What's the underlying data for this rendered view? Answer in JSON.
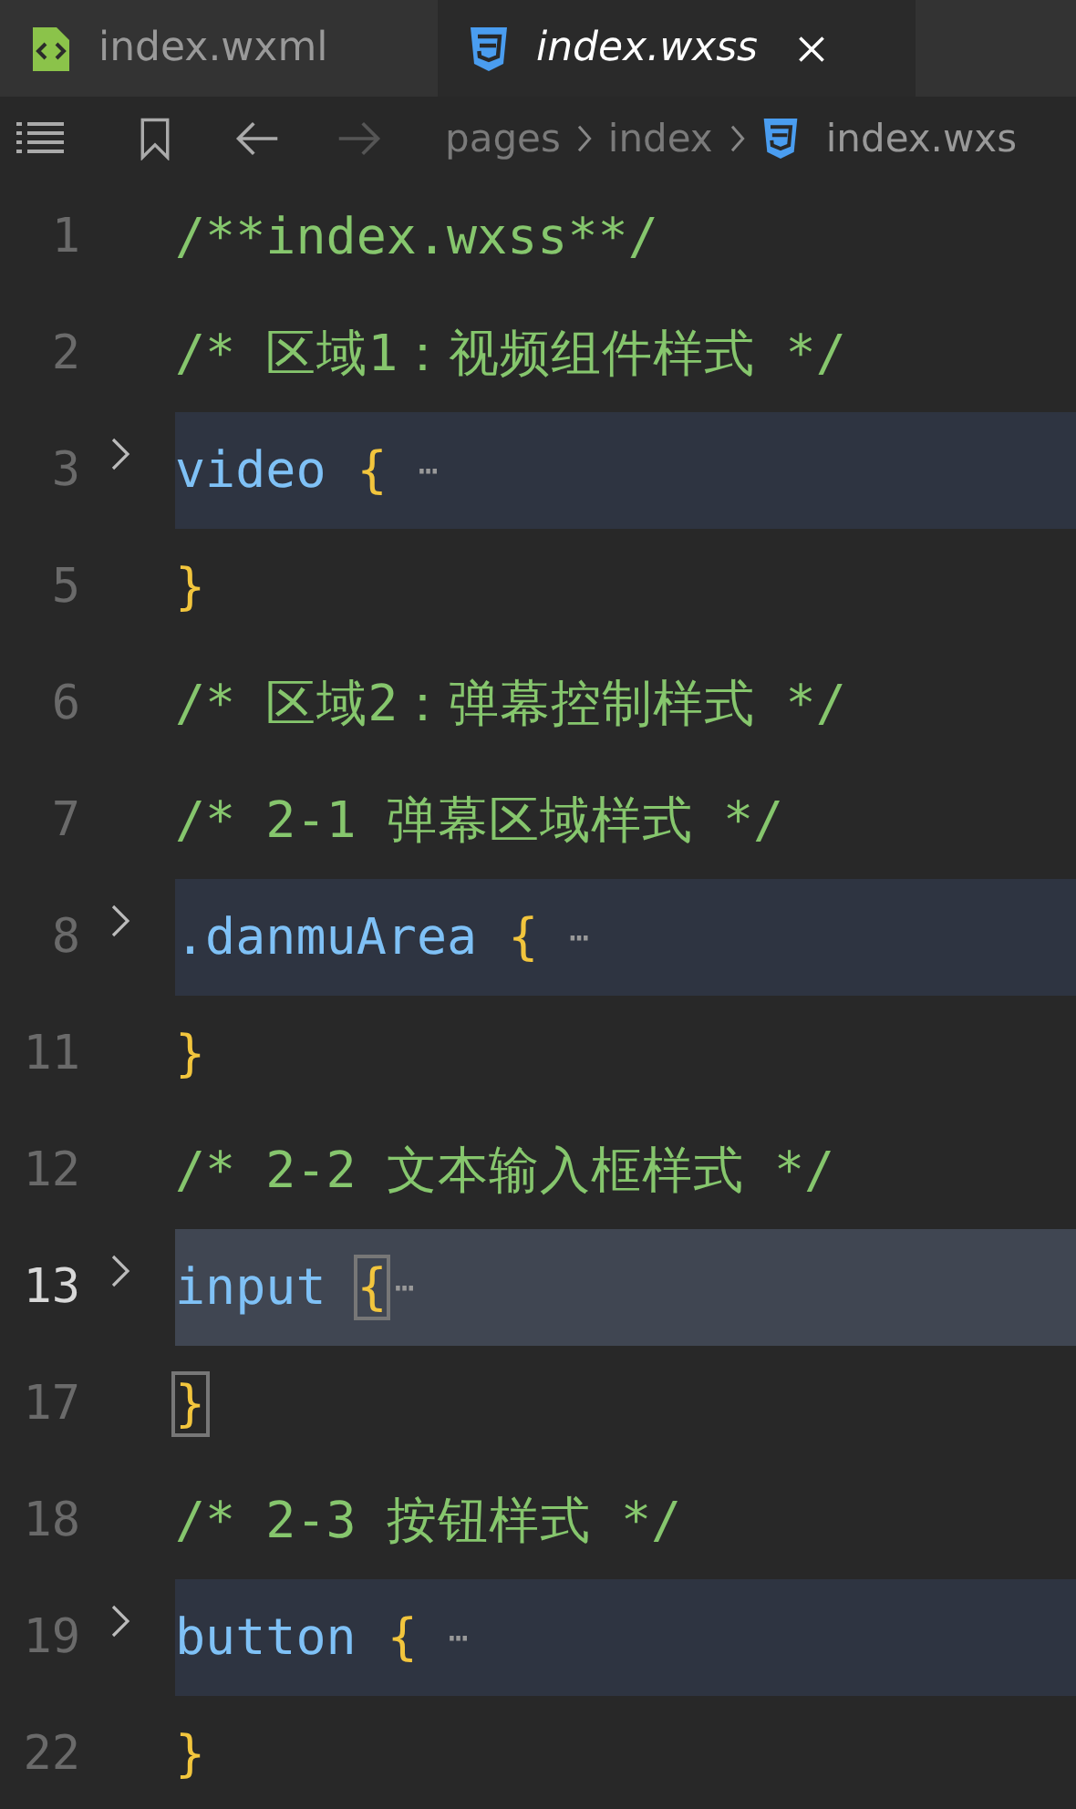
{
  "tabs": [
    {
      "label": "index.wxml",
      "kind": "wxml",
      "selected": false
    },
    {
      "label": "index.wxss",
      "kind": "wxss",
      "selected": true
    }
  ],
  "breadcrumb": [
    {
      "label": "pages",
      "kind": "folder"
    },
    {
      "label": "index",
      "kind": "folder"
    },
    {
      "label": "index.wxs",
      "kind": "wxss"
    }
  ],
  "lines": [
    {
      "number": "1",
      "folded": false,
      "current": false,
      "tokens": [
        {
          "kind": "comment",
          "text": "/**index.wxss**/"
        }
      ]
    },
    {
      "number": "2",
      "folded": false,
      "current": false,
      "tokens": [
        {
          "kind": "comment",
          "text": "/* 区域1：视频组件样式 */"
        }
      ]
    },
    {
      "number": "3",
      "folded": true,
      "current": false,
      "tokens": [
        {
          "kind": "selector",
          "text": "video"
        },
        {
          "kind": "brace",
          "text": "{",
          "matched": false
        },
        {
          "kind": "ellipsis",
          "text": "⋯"
        }
      ]
    },
    {
      "number": "5",
      "folded": false,
      "current": false,
      "tokens": [
        {
          "kind": "brace",
          "text": "}",
          "matched": false
        }
      ]
    },
    {
      "number": "6",
      "folded": false,
      "current": false,
      "tokens": [
        {
          "kind": "comment",
          "text": "/* 区域2：弹幕控制样式 */"
        }
      ]
    },
    {
      "number": "7",
      "folded": false,
      "current": false,
      "tokens": [
        {
          "kind": "comment",
          "text": "/* 2-1 弹幕区域样式 */"
        }
      ]
    },
    {
      "number": "8",
      "folded": true,
      "current": false,
      "tokens": [
        {
          "kind": "selector",
          "text": ".danmuArea"
        },
        {
          "kind": "brace",
          "text": "{",
          "matched": false
        },
        {
          "kind": "ellipsis",
          "text": "⋯"
        }
      ]
    },
    {
      "number": "11",
      "folded": false,
      "current": false,
      "tokens": [
        {
          "kind": "brace",
          "text": "}",
          "matched": false
        }
      ]
    },
    {
      "number": "12",
      "folded": false,
      "current": false,
      "tokens": [
        {
          "kind": "comment",
          "text": "/* 2-2 文本输入框样式 */"
        }
      ]
    },
    {
      "number": "13",
      "folded": true,
      "current": true,
      "tokens": [
        {
          "kind": "selector",
          "text": "input"
        },
        {
          "kind": "brace",
          "text": "{",
          "matched": true
        },
        {
          "kind": "ellipsis",
          "text": "⋯"
        }
      ]
    },
    {
      "number": "17",
      "folded": false,
      "current": false,
      "tokens": [
        {
          "kind": "brace",
          "text": "}",
          "matched": true
        }
      ]
    },
    {
      "number": "18",
      "folded": false,
      "current": false,
      "tokens": [
        {
          "kind": "comment",
          "text": "/* 2-3 按钮样式 */"
        }
      ]
    },
    {
      "number": "19",
      "folded": true,
      "current": false,
      "tokens": [
        {
          "kind": "selector",
          "text": "button"
        },
        {
          "kind": "brace",
          "text": "{",
          "matched": false
        },
        {
          "kind": "ellipsis",
          "text": "⋯"
        }
      ]
    },
    {
      "number": "22",
      "folded": false,
      "current": false,
      "tokens": [
        {
          "kind": "brace",
          "text": "}",
          "matched": false
        }
      ]
    }
  ]
}
